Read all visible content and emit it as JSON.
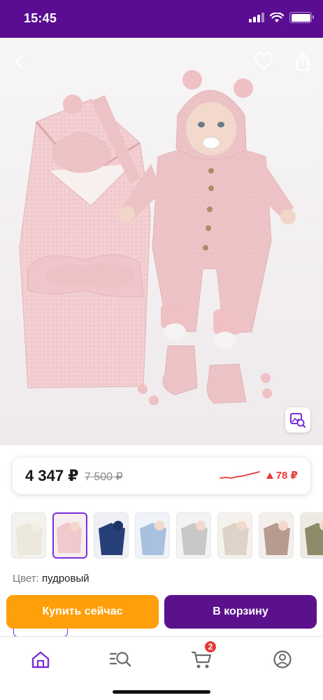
{
  "status_bar": {
    "time": "15:45",
    "icons": [
      "signal-icon",
      "wifi-icon",
      "battery-icon"
    ],
    "background": "#5a0c93"
  },
  "product": {
    "image_controls": [
      "back-icon",
      "heart-icon",
      "share-icon",
      "image-search-icon"
    ],
    "price_current": "4 347 ₽",
    "price_old": "7 500 ₽",
    "price_change": "78 ₽",
    "price_change_color": "#e53935"
  },
  "thumbnails": {
    "count": 8,
    "selected_index": 1
  },
  "color": {
    "label": "Цвет:",
    "value": "пудровый"
  },
  "actions": {
    "buy_now": "Купить сейчас",
    "to_cart": "В корзину",
    "buy_color": "#ff9f0a",
    "cart_color": "#5b108c"
  },
  "tab_bar": {
    "items": [
      "home-icon",
      "catalog-search-icon",
      "cart-icon",
      "profile-icon"
    ],
    "active": "home-icon",
    "cart_badge": "2"
  }
}
